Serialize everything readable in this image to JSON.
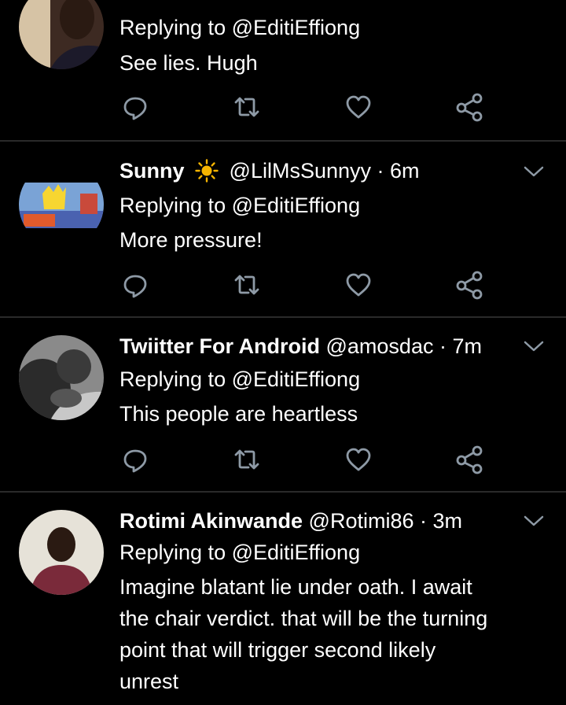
{
  "colors": {
    "background": "#000000",
    "text": "#ffffff",
    "icon": "#8e9aa6",
    "divider": "#2a2a2a",
    "sun": "#f5b400"
  },
  "tweets": [
    {
      "reply_line": "Replying to @EditiEffiong",
      "body": "See lies. Hugh",
      "icons": [
        "reply-icon",
        "retweet-icon",
        "like-icon",
        "share-icon"
      ]
    },
    {
      "display_name": "Sunny",
      "emoji": "sun-icon",
      "handle_time": "@LilMsSunnyy · 6m",
      "reply_line": "Replying to @EditiEffiong",
      "body": "More pressure!",
      "icons": [
        "reply-icon",
        "retweet-icon",
        "like-icon",
        "share-icon"
      ]
    },
    {
      "display_name": "Twiitter For Android",
      "handle_time": "@amosdac · 7m",
      "reply_line": "Replying to @EditiEffiong",
      "body": "This people are heartless",
      "icons": [
        "reply-icon",
        "retweet-icon",
        "like-icon",
        "share-icon"
      ]
    },
    {
      "display_name": "Rotimi Akinwande",
      "handle_time": "@Rotimi86 · 3m",
      "reply_line": "Replying to @EditiEffiong",
      "body_lines": [
        "Imagine blatant lie under oath. I await",
        "the chair verdict. that will be the turning",
        "point that will trigger second likely",
        "unrest"
      ]
    }
  ]
}
